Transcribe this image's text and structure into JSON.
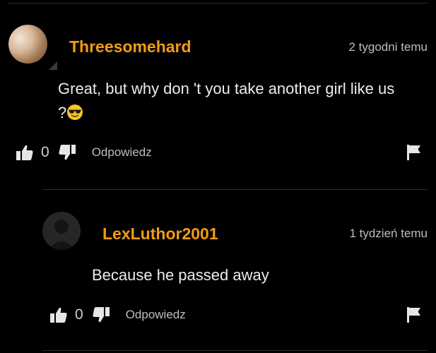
{
  "comments": [
    {
      "username": "Threesomehard",
      "timestamp": "2 tygodni temu",
      "text": "Great, but why don 't you take another girl like us",
      "text_line2": "?",
      "emoji": "smiling-face-with-sunglasses",
      "avatar": "user-photo",
      "likes": "0",
      "reply_label": "Odpowiedz"
    },
    {
      "username": "LexLuthor2001",
      "timestamp": "1 tydzień temu",
      "text": "Because he passed away",
      "avatar": "default-avatar",
      "likes": "0",
      "reply_label": "Odpowiedz"
    }
  ],
  "colors": {
    "background": "#000000",
    "username": "#f39c12",
    "text": "#ececec",
    "muted": "#bdbdbd"
  }
}
